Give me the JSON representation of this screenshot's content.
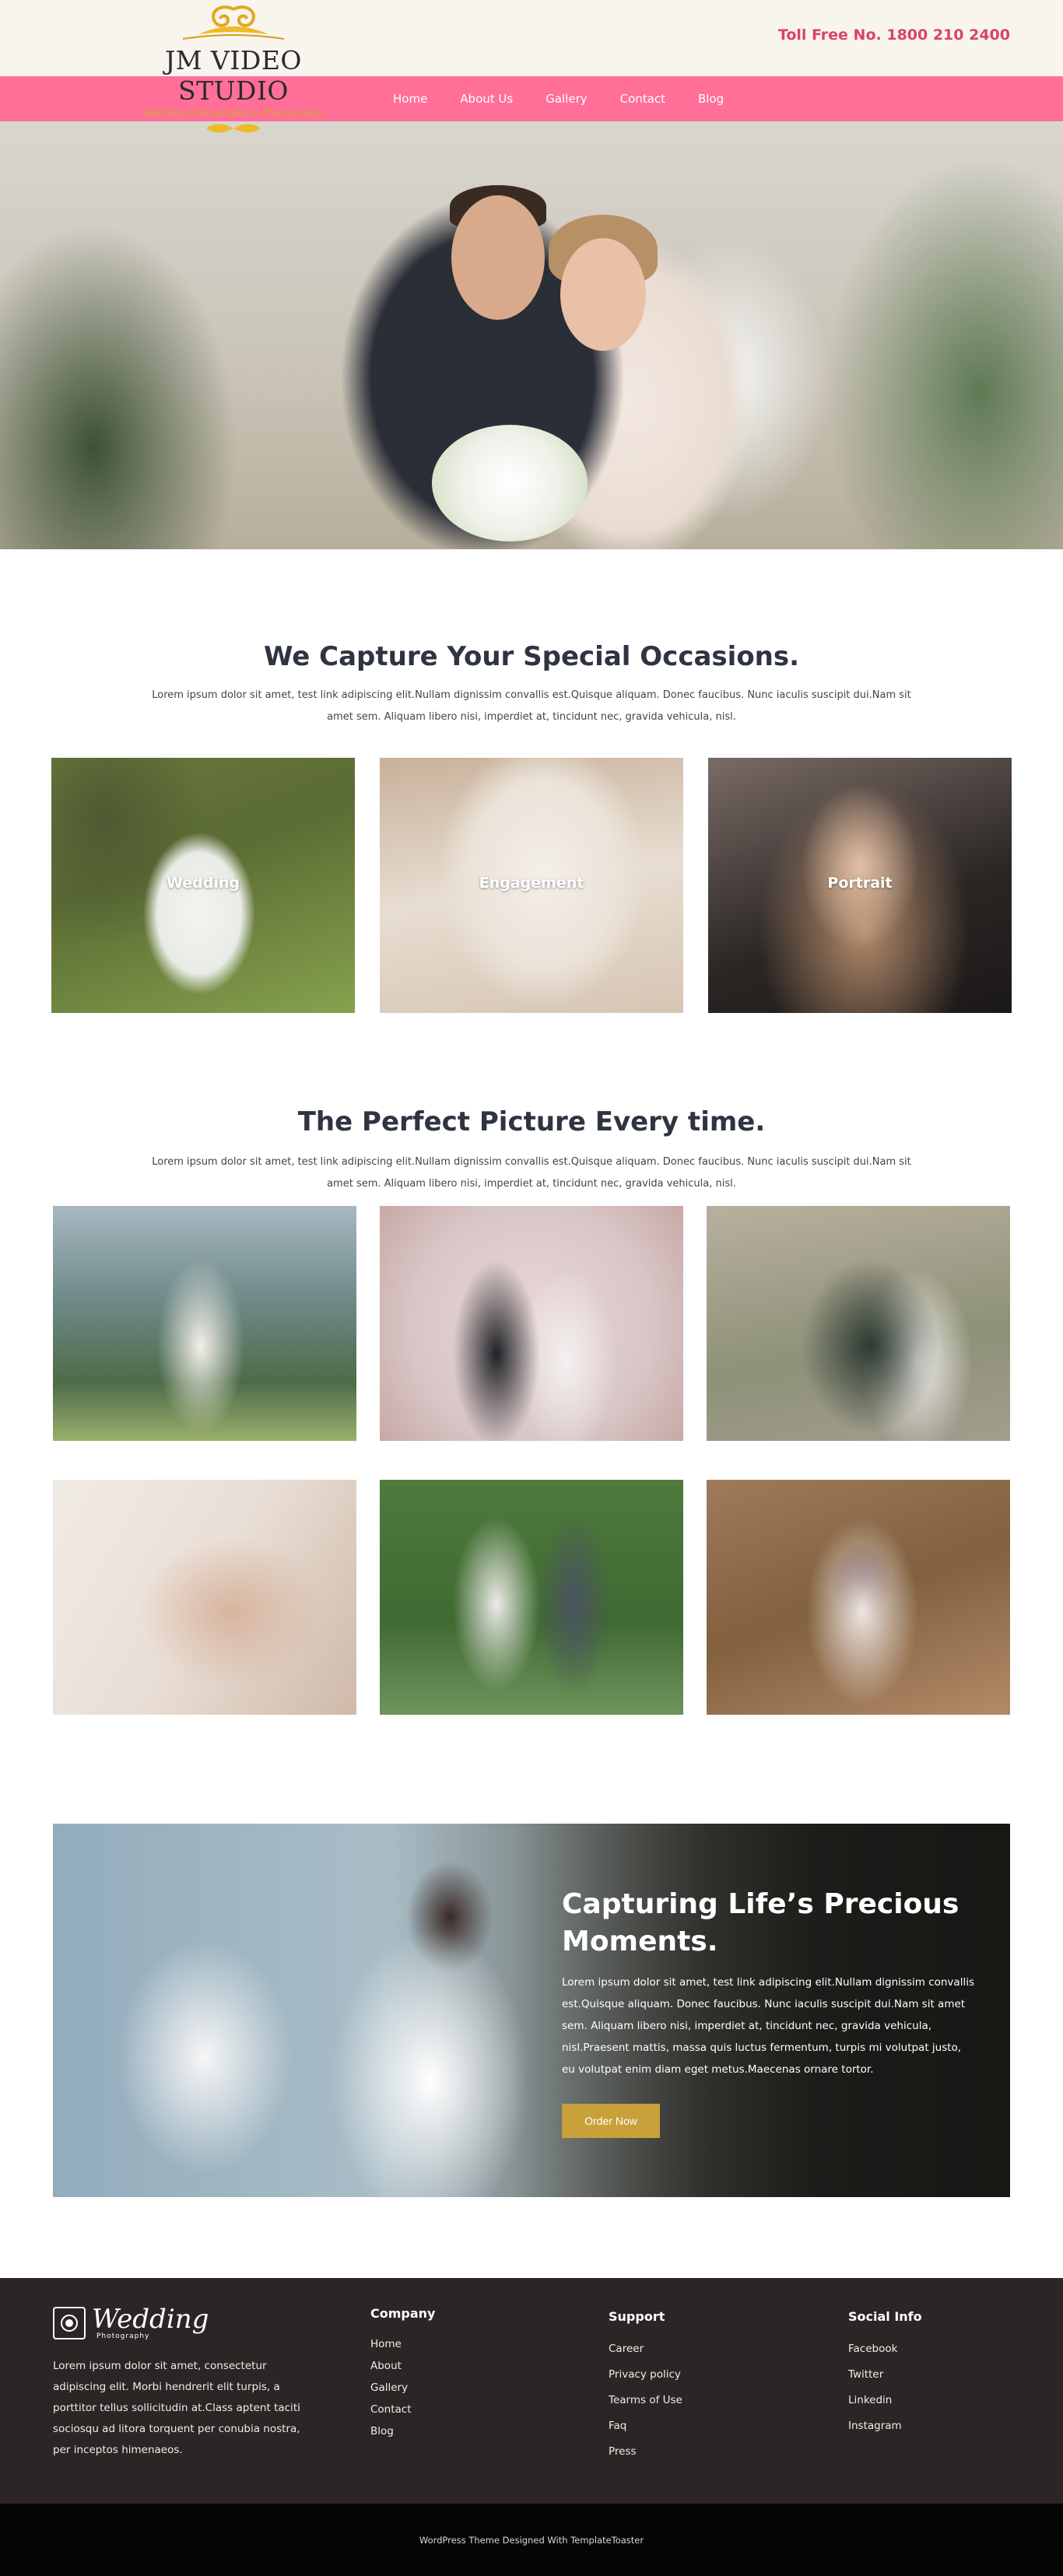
{
  "header": {
    "logo_name": "JM VIDEO STUDIO",
    "logo_tagline": "Wedding Videography & Photography",
    "toll_free": "Toll Free No. 1800 210 2400"
  },
  "nav": {
    "items": [
      "Home",
      "About Us",
      "Gallery",
      "Contact",
      "Blog"
    ]
  },
  "occasions": {
    "title": "We Capture Your Special Occasions.",
    "text": "Lorem ipsum dolor sit amet, test link adipiscing elit.Nullam dignissim convallis est.Quisque aliquam. Donec faucibus. Nunc iaculis suscipit dui.Nam sit amet sem. Aliquam libero nisi, imperdiet at, tincidunt nec, gravida vehicula, nisl.",
    "cards": [
      "Wedding",
      "Engagement",
      "Portrait"
    ]
  },
  "perfect": {
    "title": "The Perfect Picture Every time.",
    "text": "Lorem ipsum dolor sit amet, test link adipiscing elit.Nullam dignissim convallis est.Quisque aliquam. Donec faucibus. Nunc iaculis suscipit dui.Nam sit amet sem. Aliquam libero nisi, imperdiet at, tincidunt nec, gravida vehicula, nisl."
  },
  "banner": {
    "title": "Capturing Life’s Precious Moments.",
    "text": "Lorem ipsum dolor sit amet, test link adipiscing elit.Nullam dignissim convallis est.Quisque aliquam. Donec faucibus. Nunc iaculis suscipit dui.Nam sit amet sem. Aliquam libero nisi, imperdiet at, tincidunt nec, gravida vehicula, nisl.Praesent mattis, massa quis luctus fermentum, turpis mi volutpat justo, eu volutpat enim diam eget metus.Maecenas ornare tortor.",
    "button": "Order Now"
  },
  "footer": {
    "logo_title": "Wedding",
    "logo_sub": "Photography",
    "about": "Lorem ipsum dolor sit amet, consectetur adipiscing elit. Morbi hendrerit elit turpis, a porttitor tellus sollicitudin at.Class aptent taciti sociosqu ad litora torquent per conubia nostra, per inceptos himenaeos.",
    "company": {
      "title": "Company",
      "links": [
        "Home",
        "About",
        "Gallery",
        "Contact",
        "Blog"
      ]
    },
    "support": {
      "title": "Support",
      "links": [
        "Career",
        "Privacy policy",
        "Tearms of Use",
        "Faq",
        "Press"
      ]
    },
    "social": {
      "title": "Social Info",
      "links": [
        "Facebook",
        "Twitter",
        "Linkedin",
        "Instagram"
      ]
    }
  },
  "copyright": "WordPress Theme Designed With TemplateToaster",
  "colors": {
    "nav_bg": "#ff6f98",
    "toll_free": "#d8436e",
    "button": "#c9a13a",
    "footer_bg": "#2b2625"
  }
}
